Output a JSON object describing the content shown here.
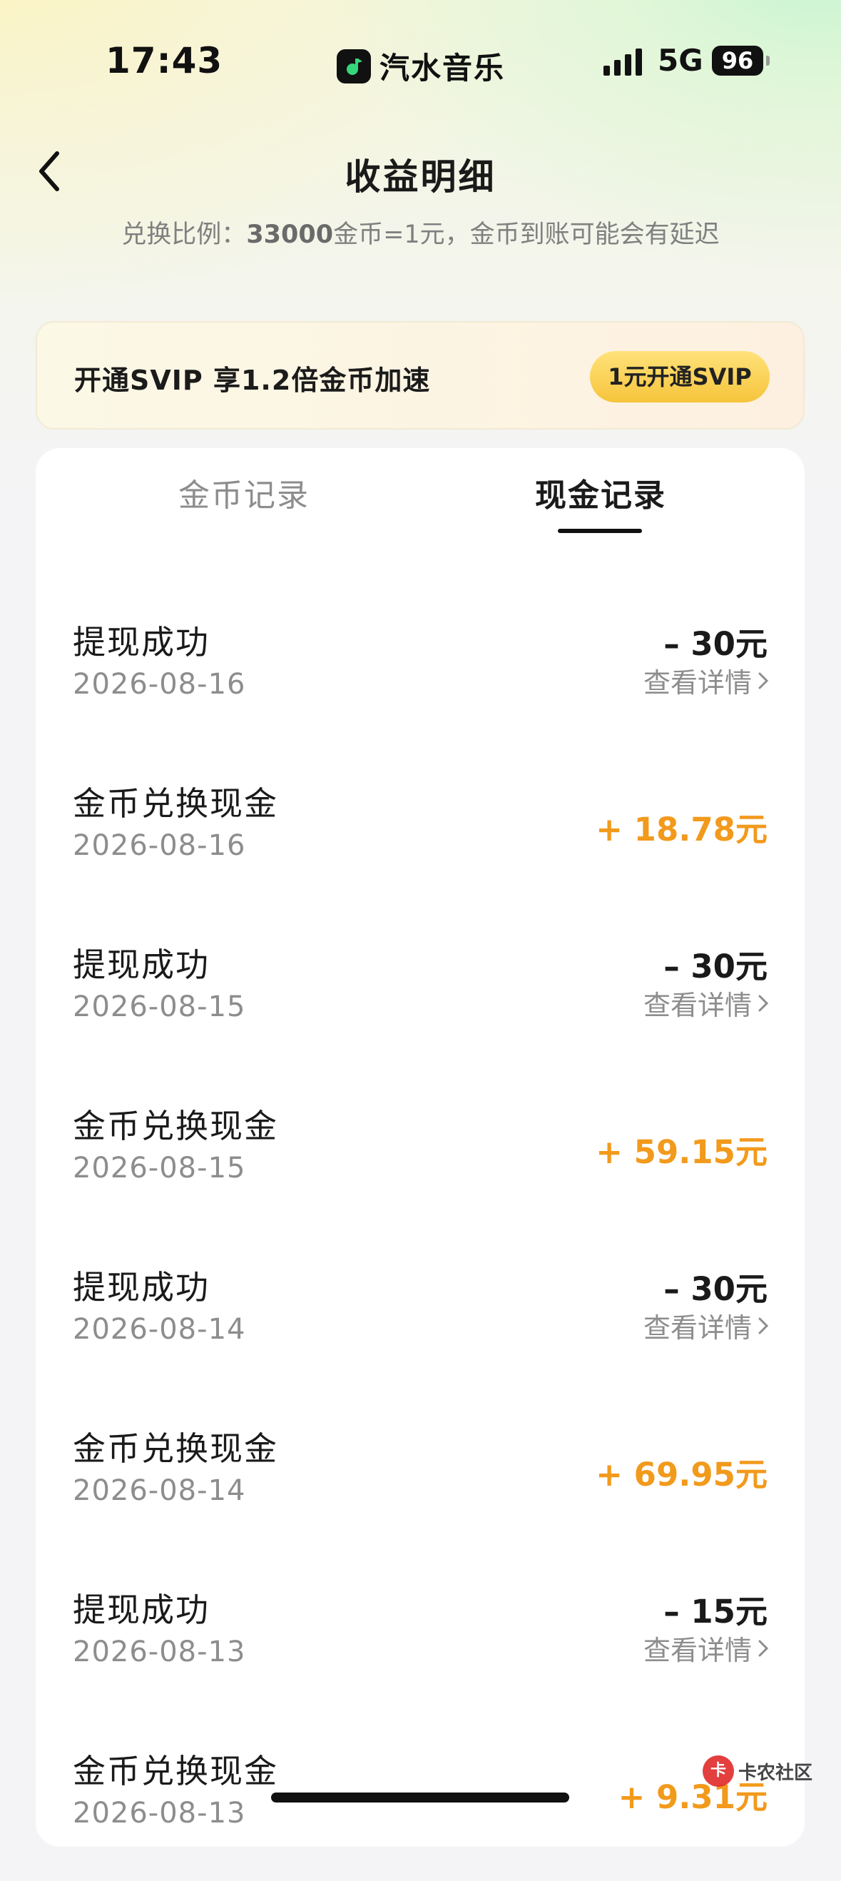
{
  "status_bar": {
    "time": "17:43",
    "app": "汽水音乐",
    "network": "5G",
    "battery": "96"
  },
  "header": {
    "title": "收益明细",
    "subtitle_prefix": "兑换比例：",
    "subtitle_rate": "33000",
    "subtitle_suffix": "金币=1元，金币到账可能会有延迟"
  },
  "svip_banner": {
    "text": "开通SVIP 享1.2倍金币加速",
    "button": "1元开通SVIP"
  },
  "tabs": [
    {
      "label": "金币记录",
      "active": false
    },
    {
      "label": "现金记录",
      "active": true
    }
  ],
  "records": [
    {
      "title": "提现成功",
      "date": "2026-08-16",
      "amount": "– 30元",
      "detail": "查看详情"
    },
    {
      "title": "金币兑换现金",
      "date": "2026-08-16",
      "amount": "+ 18.78元",
      "detail": ""
    },
    {
      "title": "提现成功",
      "date": "2026-08-15",
      "amount": "– 30元",
      "detail": "查看详情"
    },
    {
      "title": "金币兑换现金",
      "date": "2026-08-15",
      "amount": "+ 59.15元",
      "detail": ""
    },
    {
      "title": "提现成功",
      "date": "2026-08-14",
      "amount": "– 30元",
      "detail": "查看详情"
    },
    {
      "title": "金币兑换现金",
      "date": "2026-08-14",
      "amount": "+ 69.95元",
      "detail": ""
    },
    {
      "title": "提现成功",
      "date": "2026-08-13",
      "amount": "– 15元",
      "detail": "查看详情"
    },
    {
      "title": "金币兑换现金",
      "date": "2026-08-13",
      "amount": "+ 9.31元",
      "detail": ""
    }
  ],
  "watermark": {
    "text": "卡农社区"
  },
  "colors": {
    "positive": "#f29a1c",
    "negative": "#1a1a1a",
    "svip_button": "#f6c43b"
  }
}
